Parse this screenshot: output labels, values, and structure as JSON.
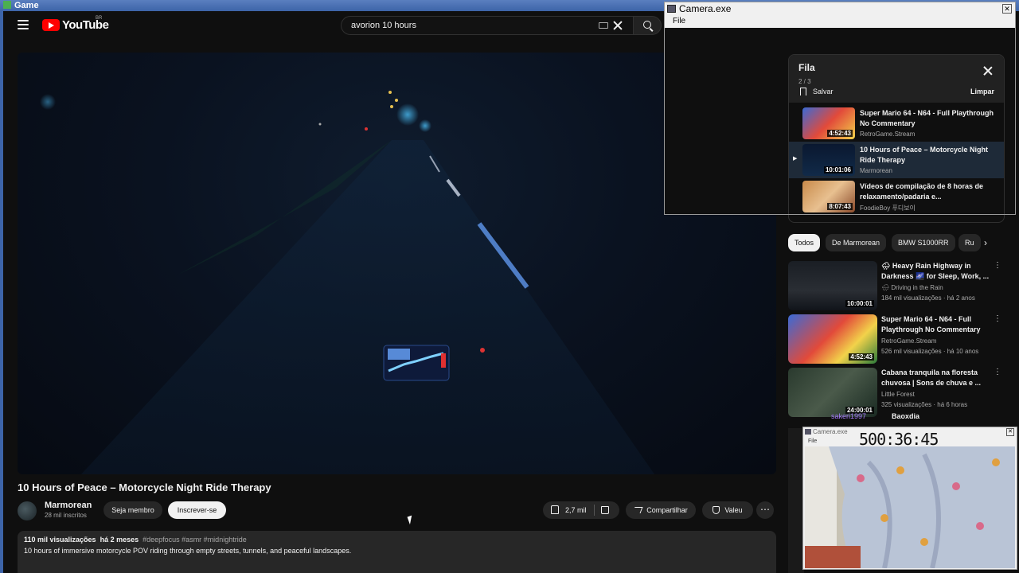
{
  "host": {
    "title": "Game"
  },
  "header": {
    "logo_text": "YouTube",
    "region": "BR",
    "search": {
      "value": "avorion 10 hours"
    }
  },
  "video": {
    "title": "10 Hours of Peace – Motorcycle Night Ride Therapy",
    "channel": "Marmorean",
    "subscribers": "28 mil inscritos",
    "member_label": "Seja membro",
    "subscribe_label": "Inscrever-se",
    "likes": "2,7 mil",
    "share_label": "Compartilhar",
    "thanks_label": "Valeu",
    "more_label": "⋯",
    "views": "110 mil visualizações",
    "age": "há 2 meses",
    "tags": "#deepfocus #asmr #midnightride",
    "description": "10 hours of immersive motorcycle POV riding through empty streets, tunnels, and peaceful landscapes."
  },
  "queue": {
    "title": "Fila",
    "count": "2 / 3",
    "save_label": "Salvar",
    "clear_label": "Limpar",
    "items": [
      {
        "title": "Super Mario 64 - N64 - Full Playthrough No Commentary",
        "channel": "RetroGame.Stream",
        "duration": "4:52:43",
        "active": false
      },
      {
        "title": "10 Hours of Peace – Motorcycle Night Ride Therapy",
        "channel": "Marmorean",
        "duration": "10:01:06",
        "active": true
      },
      {
        "title": "Vídeos de compilação de 8 horas de relaxamento/padaria e...",
        "channel": "FoodieBoy 푸디보이",
        "duration": "8:07:43",
        "active": false
      }
    ]
  },
  "chips": [
    "Todos",
    "De Marmorean",
    "BMW S1000RR",
    "Ru"
  ],
  "recommendations": [
    {
      "title": "🌧 Heavy Rain Highway in Darkness 🌌 for Sleep, Work, ...",
      "channel": "🌧 Driving in the Rain",
      "meta": "184 mil visualizações · há 2 anos",
      "duration": "10:00:01"
    },
    {
      "title": "Super Mario 64 - N64 - Full Playthrough No Commentary",
      "channel": "RetroGame.Stream",
      "meta": "526 mil visualizações · há 10 anos",
      "duration": "4:52:43"
    },
    {
      "title": "Cabana tranquila na floresta chuvosa | Sons de chuva e ...",
      "channel": "Little Forest",
      "meta": "325 visualizações · há 6 horas",
      "duration": "24:00:01"
    }
  ],
  "overlay_chat": {
    "user": "sakeri1997",
    "text": "Baoxdia"
  },
  "camera1": {
    "title": "Camera.exe",
    "menu": "File"
  },
  "camera2": {
    "title": "Camera.exe",
    "menu": "File",
    "timer": "500:36:45"
  },
  "colors": {
    "youtube_red": "#ff0000",
    "background": "#0f0f0f",
    "chip_bg": "#272727"
  }
}
